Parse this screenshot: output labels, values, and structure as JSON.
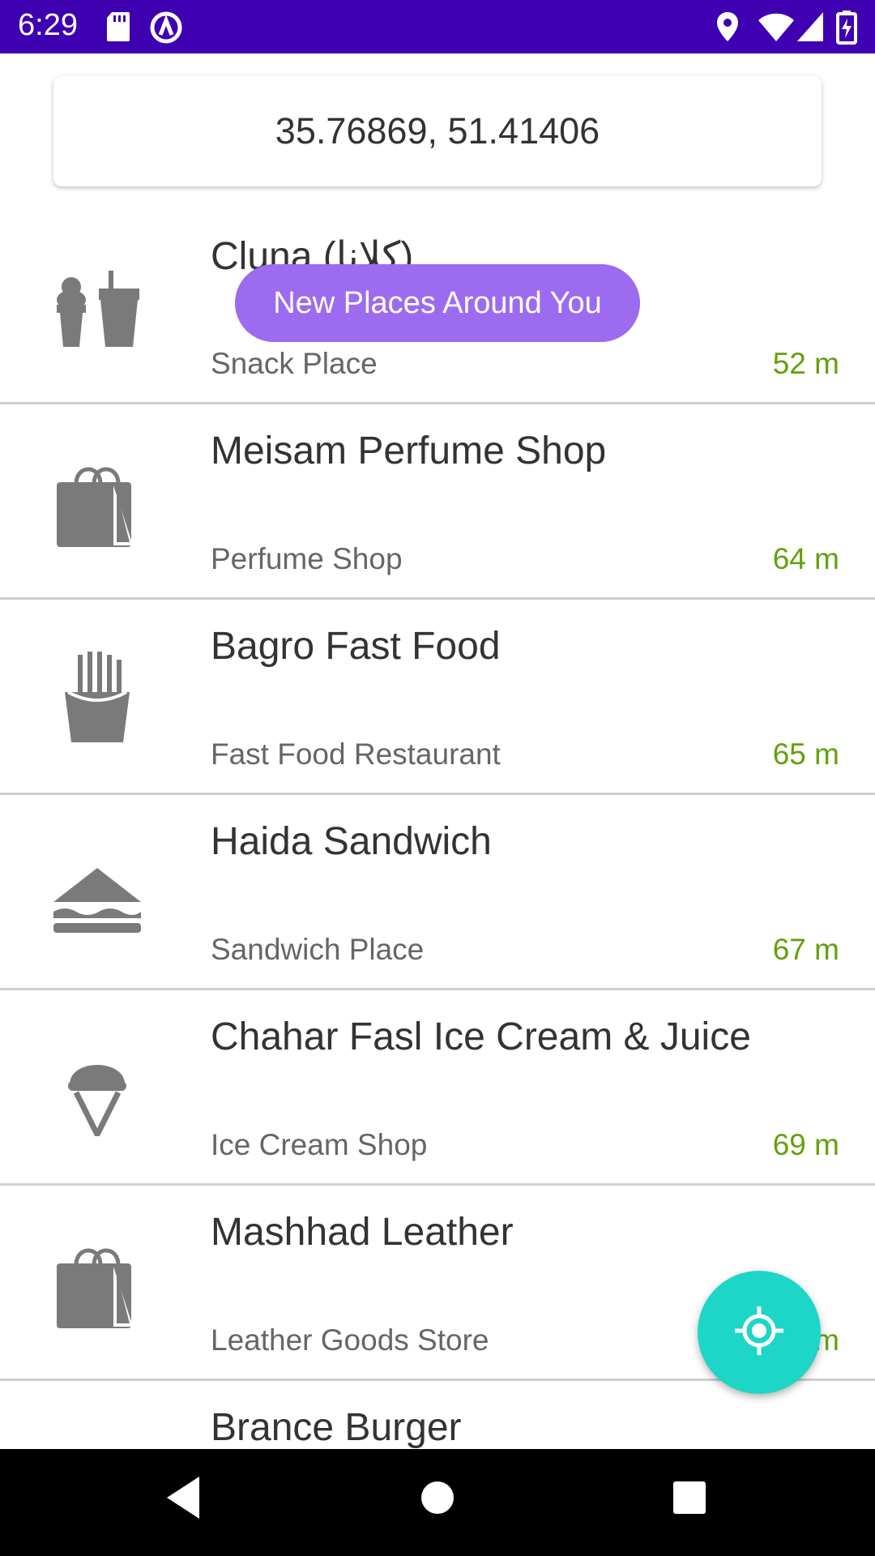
{
  "status_bar": {
    "time": "6:29",
    "icons": [
      "sd-card-icon",
      "sync-icon",
      "location-icon",
      "wifi-icon",
      "signal-icon",
      "battery-charging-icon"
    ]
  },
  "location": {
    "coordinates": "35.76869, 51.41406"
  },
  "toast": {
    "message": "New Places Around You"
  },
  "places": [
    {
      "name": "Cluna (کلانا)",
      "category": "Snack Place",
      "distance": "52 m",
      "icon": "snack-icon"
    },
    {
      "name": "Meisam Perfume Shop",
      "category": "Perfume Shop",
      "distance": "64 m",
      "icon": "shopping-bag-icon"
    },
    {
      "name": "Bagro Fast Food",
      "category": "Fast Food Restaurant",
      "distance": "65 m",
      "icon": "fries-icon"
    },
    {
      "name": "Haida Sandwich",
      "category": "Sandwich Place",
      "distance": "67 m",
      "icon": "sandwich-icon"
    },
    {
      "name": "Chahar Fasl Ice Cream & Juice",
      "category": "Ice Cream Shop",
      "distance": "69 m",
      "icon": "ice-cream-icon"
    },
    {
      "name": "Mashhad Leather",
      "category": "Leather Goods Store",
      "distance": "m",
      "icon": "shopping-bag-icon"
    },
    {
      "name": "Brance Burger",
      "icon": "burger-icon"
    }
  ],
  "fab": {
    "icon": "my-location-icon"
  },
  "nav": {
    "icons": [
      "back-icon",
      "home-icon",
      "recents-icon"
    ]
  },
  "colors": {
    "status_bar": "#3e00b1",
    "toast": "#9d6bef",
    "distance": "#63a10c",
    "fab": "#1dd6c8"
  }
}
